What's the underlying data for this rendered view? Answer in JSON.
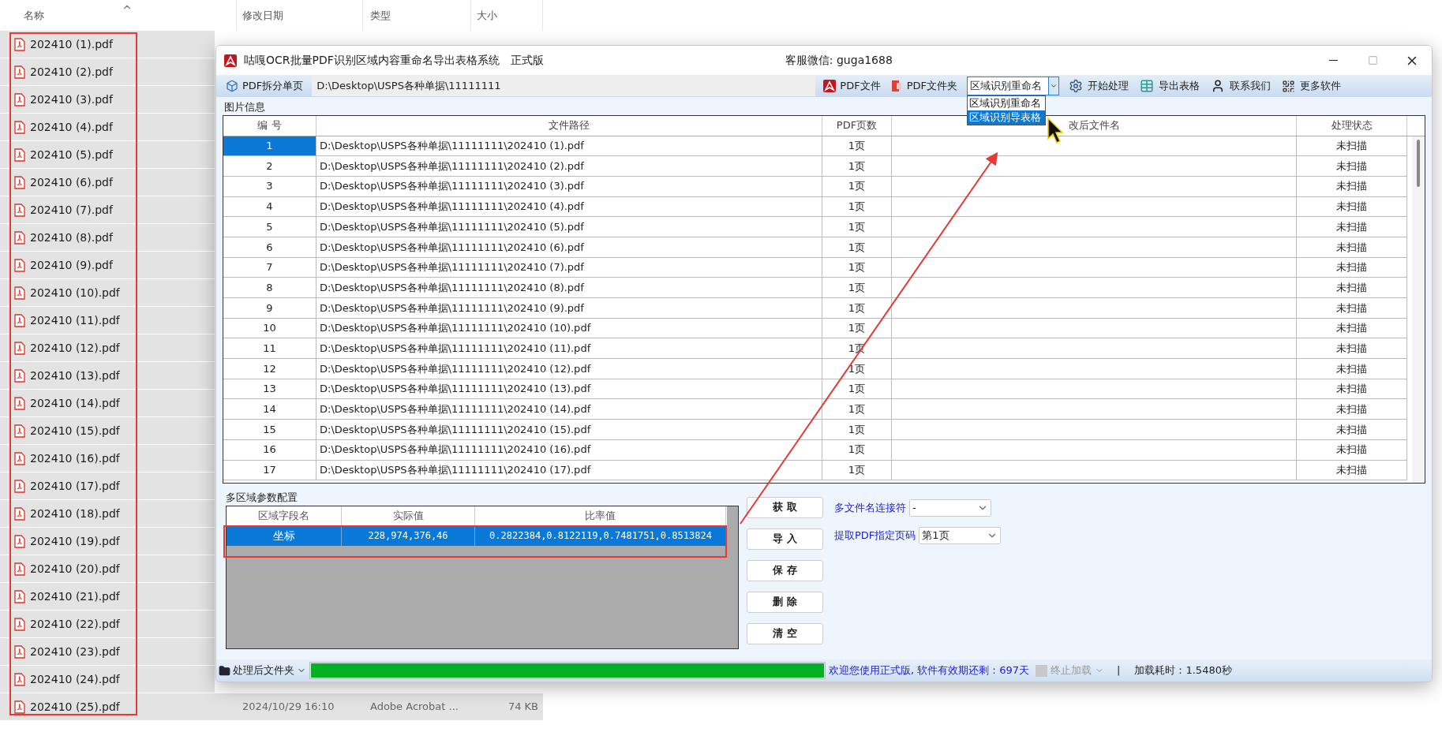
{
  "explorer": {
    "columns": [
      "名称",
      "修改日期",
      "类型",
      "大小"
    ],
    "files": [
      {
        "name": "202410 (1).pdf",
        "selected": true
      },
      {
        "name": "202410 (2).pdf",
        "selected": true
      },
      {
        "name": "202410 (3).pdf",
        "selected": true
      },
      {
        "name": "202410 (4).pdf",
        "selected": true
      },
      {
        "name": "202410 (5).pdf",
        "selected": true
      },
      {
        "name": "202410 (6).pdf",
        "selected": true
      },
      {
        "name": "202410 (7).pdf",
        "selected": true
      },
      {
        "name": "202410 (8).pdf",
        "selected": true
      },
      {
        "name": "202410 (9).pdf",
        "selected": true
      },
      {
        "name": "202410 (10).pdf",
        "selected": true
      },
      {
        "name": "202410 (11).pdf",
        "selected": true
      },
      {
        "name": "202410 (12).pdf",
        "selected": true
      },
      {
        "name": "202410 (13).pdf",
        "selected": true
      },
      {
        "name": "202410 (14).pdf",
        "selected": true
      },
      {
        "name": "202410 (15).pdf",
        "selected": true
      },
      {
        "name": "202410 (16).pdf",
        "selected": true
      },
      {
        "name": "202410 (17).pdf",
        "selected": true
      },
      {
        "name": "202410 (18).pdf",
        "selected": true
      },
      {
        "name": "202410 (19).pdf",
        "selected": true
      },
      {
        "name": "202410 (20).pdf",
        "selected": true
      },
      {
        "name": "202410 (21).pdf",
        "selected": true
      },
      {
        "name": "202410 (22).pdf",
        "selected": true
      },
      {
        "name": "202410 (23).pdf",
        "selected": true
      },
      {
        "name": "202410 (24).pdf",
        "selected": true
      },
      {
        "name": "202410 (25).pdf",
        "selected": true,
        "date": "2024/10/29 16:10",
        "type": "Adobe Acrobat ...",
        "size": "74 KB"
      }
    ]
  },
  "window": {
    "title": "咕嘎OCR批量PDF识别区域内容重命名导出表格系统",
    "edition": "正式版",
    "contact": "客服微信: guga1688"
  },
  "toolbar": {
    "split_button": "PDF拆分单页",
    "path": "D:\\Desktop\\USPS各种单据\\11111111",
    "buttons": [
      {
        "kind": "pdf",
        "label": "PDF文件"
      },
      {
        "kind": "folder",
        "label": "PDF文件夹"
      }
    ],
    "mode": {
      "value": "区域识别重命名",
      "expanded": true,
      "options": [
        {
          "label": "区域识别重命名",
          "highlighted": false
        },
        {
          "label": "区域识别导表格",
          "highlighted": true
        }
      ]
    },
    "actions": [
      {
        "kind": "gear",
        "label": "开始处理"
      },
      {
        "kind": "table",
        "label": "导出表格"
      },
      {
        "kind": "contact",
        "label": "联系我们"
      },
      {
        "kind": "grid",
        "label": "更多软件"
      }
    ]
  },
  "image_info": {
    "title": "图片信息",
    "columns": [
      "编 号",
      "文件路径",
      "PDF页数",
      "改后文件名",
      "处理状态"
    ],
    "rows": [
      {
        "no": "1",
        "path": "D:\\Desktop\\USPS各种单据\\11111111\\202410 (1).pdf",
        "pages": "1页",
        "status": "未扫描",
        "selected": true
      },
      {
        "no": "2",
        "path": "D:\\Desktop\\USPS各种单据\\11111111\\202410 (2).pdf",
        "pages": "1页",
        "status": "未扫描",
        "selected": false
      },
      {
        "no": "3",
        "path": "D:\\Desktop\\USPS各种单据\\11111111\\202410 (3).pdf",
        "pages": "1页",
        "status": "未扫描",
        "selected": false
      },
      {
        "no": "4",
        "path": "D:\\Desktop\\USPS各种单据\\11111111\\202410 (4).pdf",
        "pages": "1页",
        "status": "未扫描",
        "selected": false
      },
      {
        "no": "5",
        "path": "D:\\Desktop\\USPS各种单据\\11111111\\202410 (5).pdf",
        "pages": "1页",
        "status": "未扫描",
        "selected": false
      },
      {
        "no": "6",
        "path": "D:\\Desktop\\USPS各种单据\\11111111\\202410 (6).pdf",
        "pages": "1页",
        "status": "未扫描",
        "selected": false
      },
      {
        "no": "7",
        "path": "D:\\Desktop\\USPS各种单据\\11111111\\202410 (7).pdf",
        "pages": "1页",
        "status": "未扫描",
        "selected": false
      },
      {
        "no": "8",
        "path": "D:\\Desktop\\USPS各种单据\\11111111\\202410 (8).pdf",
        "pages": "1页",
        "status": "未扫描",
        "selected": false
      },
      {
        "no": "9",
        "path": "D:\\Desktop\\USPS各种单据\\11111111\\202410 (9).pdf",
        "pages": "1页",
        "status": "未扫描",
        "selected": false
      },
      {
        "no": "10",
        "path": "D:\\Desktop\\USPS各种单据\\11111111\\202410 (10).pdf",
        "pages": "1页",
        "status": "未扫描",
        "selected": false
      },
      {
        "no": "11",
        "path": "D:\\Desktop\\USPS各种单据\\11111111\\202410 (11).pdf",
        "pages": "1页",
        "status": "未扫描",
        "selected": false
      },
      {
        "no": "12",
        "path": "D:\\Desktop\\USPS各种单据\\11111111\\202410 (12).pdf",
        "pages": "1页",
        "status": "未扫描",
        "selected": false
      },
      {
        "no": "13",
        "path": "D:\\Desktop\\USPS各种单据\\11111111\\202410 (13).pdf",
        "pages": "1页",
        "status": "未扫描",
        "selected": false
      },
      {
        "no": "14",
        "path": "D:\\Desktop\\USPS各种单据\\11111111\\202410 (14).pdf",
        "pages": "1页",
        "status": "未扫描",
        "selected": false
      },
      {
        "no": "15",
        "path": "D:\\Desktop\\USPS各种单据\\11111111\\202410 (15).pdf",
        "pages": "1页",
        "status": "未扫描",
        "selected": false
      },
      {
        "no": "16",
        "path": "D:\\Desktop\\USPS各种单据\\11111111\\202410 (16).pdf",
        "pages": "1页",
        "status": "未扫描",
        "selected": false
      },
      {
        "no": "17",
        "path": "D:\\Desktop\\USPS各种单据\\11111111\\202410 (17).pdf",
        "pages": "1页",
        "status": "未扫描",
        "selected": false
      }
    ]
  },
  "regions": {
    "title": "多区域参数配置",
    "columns": [
      "区域字段名",
      "实际值",
      "比率值"
    ],
    "rows": [
      {
        "name": "坐标",
        "actual": "228,974,376,46",
        "ratio": "0.2822384,0.8122119,0.7481751,0.8513824",
        "selected": true
      }
    ],
    "buttons": [
      "获 取",
      "导 入",
      "保 存",
      "删 除",
      "清 空"
    ]
  },
  "options": [
    {
      "label": "多文件名连接符",
      "value": "-"
    },
    {
      "label": "提取PDF指定页码",
      "value": "第1页"
    }
  ],
  "status_bar": {
    "folder_button": "处理后文件夹",
    "progress": {
      "level": 1
    },
    "message": "欢迎您使用正式版, 软件有效期还剩：697天",
    "stop": {
      "label": "终止加载",
      "disabled": true
    },
    "separator": "|",
    "load_time": "加载耗时：1.5480秒"
  }
}
